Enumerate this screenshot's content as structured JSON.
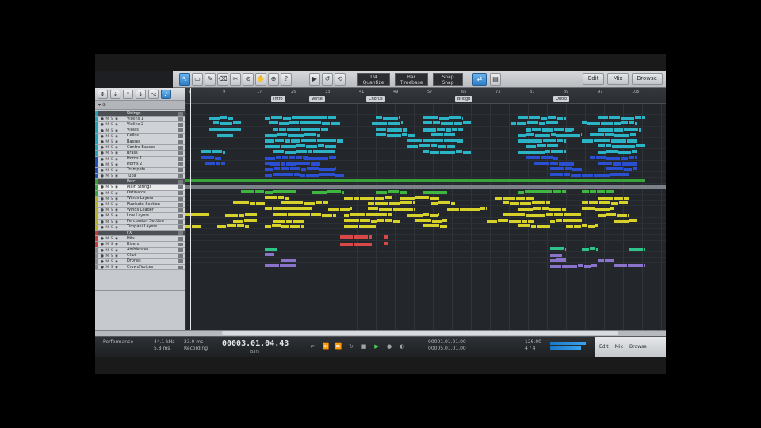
{
  "toolbar": {
    "tools": [
      "↖",
      "▭",
      "✎",
      "⌫",
      "✂",
      "⊘",
      "✋",
      "⊕",
      "?"
    ],
    "transport_buttons": [
      "▶",
      "↺",
      "⟲"
    ],
    "fields": [
      {
        "value": "1/4",
        "label": "Quantize"
      },
      {
        "value": "Bar",
        "label": "Timebase"
      },
      {
        "value": "Snap",
        "label": "Snap"
      }
    ],
    "tabs": [
      "Edit",
      "Mix",
      "Browse"
    ]
  },
  "left_panel": {
    "tools": [
      "↕",
      "⇣",
      "↑",
      "↓",
      "⌥",
      "♪"
    ],
    "subheader": "▾  ⊕",
    "tracks": [
      {
        "name": "Strings",
        "folder": true,
        "color": "#1fa3b6"
      },
      {
        "name": "Violins 1",
        "color": "#1fa3b6"
      },
      {
        "name": "Violins 2",
        "color": "#1fa3b6"
      },
      {
        "name": "Violas",
        "color": "#1fa3b6"
      },
      {
        "name": "Cellos",
        "color": "#1fa3b6"
      },
      {
        "name": "Basses",
        "color": "#1fa3b6"
      },
      {
        "name": "Contra Basses",
        "color": "#1fa3b6"
      },
      {
        "name": "Brass",
        "color": "#1fa3b6"
      },
      {
        "name": "Horns 1",
        "color": "#1f4db6"
      },
      {
        "name": "Horns 2",
        "color": "#1f4db6"
      },
      {
        "name": "Trumpets",
        "color": "#1f4db6"
      },
      {
        "name": "Tuba",
        "color": "#1f4db6"
      },
      {
        "name": "Perc",
        "folder": true,
        "color": "#3aa23a"
      },
      {
        "name": "Main Strings",
        "color": "#3aa23a",
        "selected": true
      },
      {
        "name": "Ostinatos",
        "color": "#3aa23a"
      },
      {
        "name": "Winds Layers",
        "color": "#b6b21f"
      },
      {
        "name": "Pizzicato Section",
        "color": "#b6b21f"
      },
      {
        "name": "Winds Leader",
        "color": "#b6b21f"
      },
      {
        "name": "Low Layers",
        "color": "#b6b21f"
      },
      {
        "name": "Percussion Section",
        "color": "#b6b21f"
      },
      {
        "name": "Timpani Layers",
        "color": "#b6b21f"
      },
      {
        "name": "FX",
        "folder": true,
        "color": "#c93a3a"
      },
      {
        "name": "Hits",
        "color": "#c93a3a"
      },
      {
        "name": "Risers",
        "color": "#c93a3a"
      },
      {
        "name": "Ambiences",
        "color": "#8a8e93"
      },
      {
        "name": "Choir",
        "color": "#8a8e93"
      },
      {
        "name": "Drones",
        "color": "#8a8e93"
      },
      {
        "name": "Crowd Voices",
        "color": "#8a8e93"
      }
    ]
  },
  "ruler": {
    "numbers": [
      "1",
      "9",
      "17",
      "25",
      "33",
      "41",
      "49",
      "57",
      "65",
      "73",
      "81",
      "89",
      "97",
      "105"
    ],
    "markers": [
      "Intro",
      "Verse",
      "Chorus",
      "Bridge",
      "Outro"
    ]
  },
  "transport": {
    "cpu": "Performance",
    "sample_rate": "44.1 kHz",
    "latency": "5.8 ms",
    "record": "23.0 ms",
    "max_record": "Recording",
    "time": "00003.01.04.43",
    "time_label": "Bars",
    "loop_start": "00001.01.01.00",
    "loop_end": "00005.01.01.00",
    "tempo": "126.00",
    "signature": "4 / 4",
    "right_tabs": [
      "Edit",
      "Mix",
      "Browse"
    ]
  }
}
